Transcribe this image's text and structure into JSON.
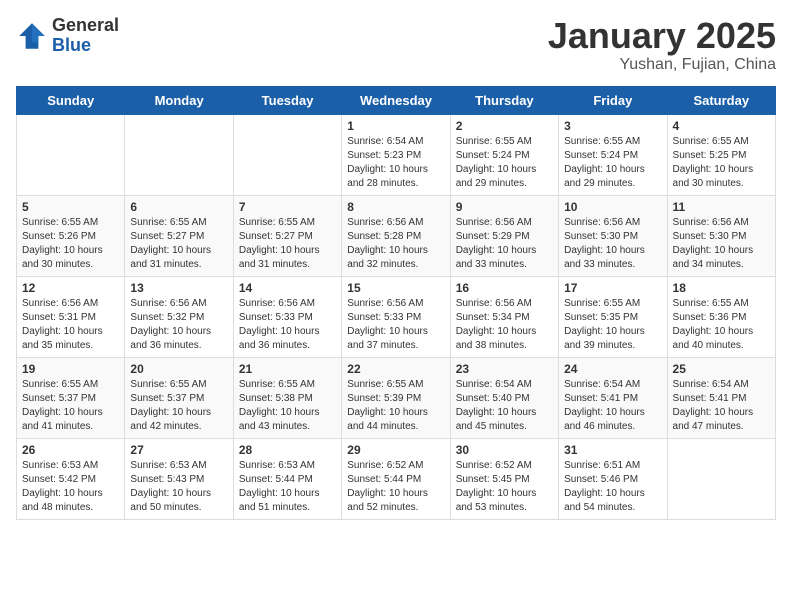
{
  "logo": {
    "general": "General",
    "blue": "Blue"
  },
  "header": {
    "month": "January 2025",
    "location": "Yushan, Fujian, China"
  },
  "weekdays": [
    "Sunday",
    "Monday",
    "Tuesday",
    "Wednesday",
    "Thursday",
    "Friday",
    "Saturday"
  ],
  "weeks": [
    [
      {
        "day": "",
        "info": ""
      },
      {
        "day": "",
        "info": ""
      },
      {
        "day": "",
        "info": ""
      },
      {
        "day": "1",
        "info": "Sunrise: 6:54 AM\nSunset: 5:23 PM\nDaylight: 10 hours\nand 28 minutes."
      },
      {
        "day": "2",
        "info": "Sunrise: 6:55 AM\nSunset: 5:24 PM\nDaylight: 10 hours\nand 29 minutes."
      },
      {
        "day": "3",
        "info": "Sunrise: 6:55 AM\nSunset: 5:24 PM\nDaylight: 10 hours\nand 29 minutes."
      },
      {
        "day": "4",
        "info": "Sunrise: 6:55 AM\nSunset: 5:25 PM\nDaylight: 10 hours\nand 30 minutes."
      }
    ],
    [
      {
        "day": "5",
        "info": "Sunrise: 6:55 AM\nSunset: 5:26 PM\nDaylight: 10 hours\nand 30 minutes."
      },
      {
        "day": "6",
        "info": "Sunrise: 6:55 AM\nSunset: 5:27 PM\nDaylight: 10 hours\nand 31 minutes."
      },
      {
        "day": "7",
        "info": "Sunrise: 6:55 AM\nSunset: 5:27 PM\nDaylight: 10 hours\nand 31 minutes."
      },
      {
        "day": "8",
        "info": "Sunrise: 6:56 AM\nSunset: 5:28 PM\nDaylight: 10 hours\nand 32 minutes."
      },
      {
        "day": "9",
        "info": "Sunrise: 6:56 AM\nSunset: 5:29 PM\nDaylight: 10 hours\nand 33 minutes."
      },
      {
        "day": "10",
        "info": "Sunrise: 6:56 AM\nSunset: 5:30 PM\nDaylight: 10 hours\nand 33 minutes."
      },
      {
        "day": "11",
        "info": "Sunrise: 6:56 AM\nSunset: 5:30 PM\nDaylight: 10 hours\nand 34 minutes."
      }
    ],
    [
      {
        "day": "12",
        "info": "Sunrise: 6:56 AM\nSunset: 5:31 PM\nDaylight: 10 hours\nand 35 minutes."
      },
      {
        "day": "13",
        "info": "Sunrise: 6:56 AM\nSunset: 5:32 PM\nDaylight: 10 hours\nand 36 minutes."
      },
      {
        "day": "14",
        "info": "Sunrise: 6:56 AM\nSunset: 5:33 PM\nDaylight: 10 hours\nand 36 minutes."
      },
      {
        "day": "15",
        "info": "Sunrise: 6:56 AM\nSunset: 5:33 PM\nDaylight: 10 hours\nand 37 minutes."
      },
      {
        "day": "16",
        "info": "Sunrise: 6:56 AM\nSunset: 5:34 PM\nDaylight: 10 hours\nand 38 minutes."
      },
      {
        "day": "17",
        "info": "Sunrise: 6:55 AM\nSunset: 5:35 PM\nDaylight: 10 hours\nand 39 minutes."
      },
      {
        "day": "18",
        "info": "Sunrise: 6:55 AM\nSunset: 5:36 PM\nDaylight: 10 hours\nand 40 minutes."
      }
    ],
    [
      {
        "day": "19",
        "info": "Sunrise: 6:55 AM\nSunset: 5:37 PM\nDaylight: 10 hours\nand 41 minutes."
      },
      {
        "day": "20",
        "info": "Sunrise: 6:55 AM\nSunset: 5:37 PM\nDaylight: 10 hours\nand 42 minutes."
      },
      {
        "day": "21",
        "info": "Sunrise: 6:55 AM\nSunset: 5:38 PM\nDaylight: 10 hours\nand 43 minutes."
      },
      {
        "day": "22",
        "info": "Sunrise: 6:55 AM\nSunset: 5:39 PM\nDaylight: 10 hours\nand 44 minutes."
      },
      {
        "day": "23",
        "info": "Sunrise: 6:54 AM\nSunset: 5:40 PM\nDaylight: 10 hours\nand 45 minutes."
      },
      {
        "day": "24",
        "info": "Sunrise: 6:54 AM\nSunset: 5:41 PM\nDaylight: 10 hours\nand 46 minutes."
      },
      {
        "day": "25",
        "info": "Sunrise: 6:54 AM\nSunset: 5:41 PM\nDaylight: 10 hours\nand 47 minutes."
      }
    ],
    [
      {
        "day": "26",
        "info": "Sunrise: 6:53 AM\nSunset: 5:42 PM\nDaylight: 10 hours\nand 48 minutes."
      },
      {
        "day": "27",
        "info": "Sunrise: 6:53 AM\nSunset: 5:43 PM\nDaylight: 10 hours\nand 50 minutes."
      },
      {
        "day": "28",
        "info": "Sunrise: 6:53 AM\nSunset: 5:44 PM\nDaylight: 10 hours\nand 51 minutes."
      },
      {
        "day": "29",
        "info": "Sunrise: 6:52 AM\nSunset: 5:44 PM\nDaylight: 10 hours\nand 52 minutes."
      },
      {
        "day": "30",
        "info": "Sunrise: 6:52 AM\nSunset: 5:45 PM\nDaylight: 10 hours\nand 53 minutes."
      },
      {
        "day": "31",
        "info": "Sunrise: 6:51 AM\nSunset: 5:46 PM\nDaylight: 10 hours\nand 54 minutes."
      },
      {
        "day": "",
        "info": ""
      }
    ]
  ]
}
